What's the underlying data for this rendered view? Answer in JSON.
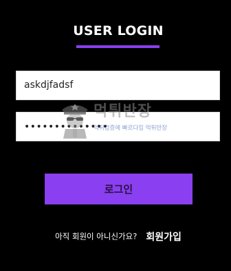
{
  "header": {
    "title": "USER LOGIN",
    "accent_color": "#8a3ff0"
  },
  "form": {
    "username_value": "askdjfadsf",
    "password_value": "••••••••••••••",
    "login_label": "로그인"
  },
  "watermark": {
    "brand_text": "먹튀반장",
    "tagline": "먹튀검증에 빠르다임 먹튀반장",
    "icon": "police-officer-mascot-icon"
  },
  "signup": {
    "question": "아직 회원이 아니신가요?",
    "link_label": "회원가입"
  },
  "colors": {
    "background": "#000000",
    "input_background": "#ffffff",
    "button_background": "#8a3ff0"
  }
}
